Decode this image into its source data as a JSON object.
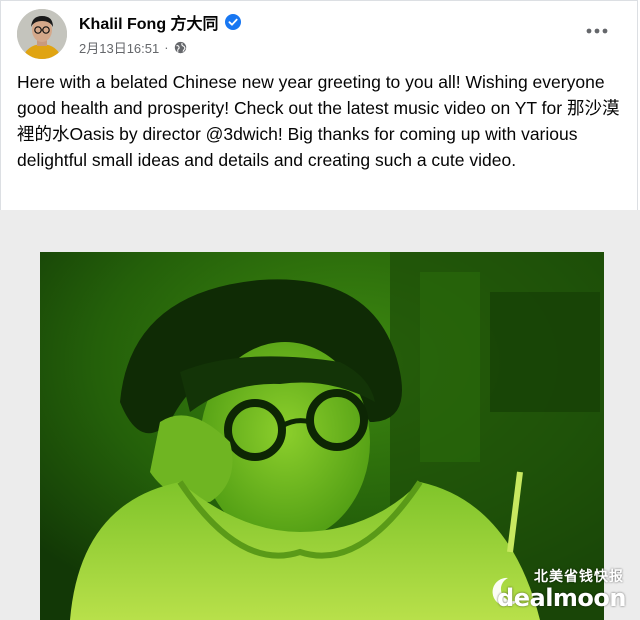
{
  "post": {
    "author_name": "Khalil Fong 方大同",
    "timestamp": "2月13日16:51",
    "separator": "·",
    "privacy_icon": "globe-icon",
    "verified_icon": "verified-badge-icon",
    "more_icon": "more-options-icon",
    "text": "Here with a belated Chinese new year greeting to you all! Wishing everyone good health and prosperity! Check out the latest music video on YT for 那沙漠裡的水Oasis by director @3dwich! Big thanks for coming up with various delightful small ideas and details and creating such a cute video."
  },
  "watermark": {
    "cn": "北美省钱快报",
    "en": "dealmoon"
  },
  "colors": {
    "verified_blue": "#1877f2",
    "meta_gray": "#65676b",
    "photo_green": "#2f7a0a"
  }
}
